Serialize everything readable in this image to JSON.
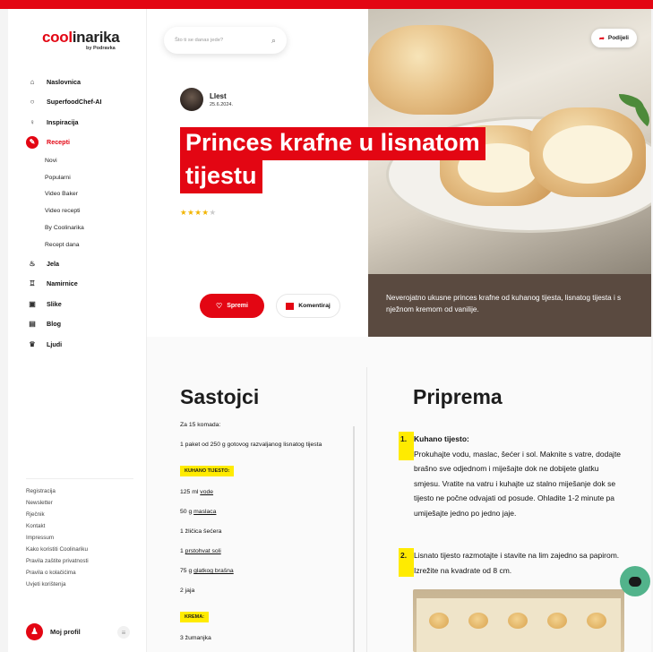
{
  "brand": {
    "logo_main": "coolinarika",
    "logo_accent": "coolinarika",
    "logo_sub": "by Podravka",
    "accent_color": "#e30613"
  },
  "sidebar": {
    "items": [
      {
        "label": "Naslovnica",
        "icon": "home-icon",
        "glyph": "⌂"
      },
      {
        "label": "SuperfoodChef-AI",
        "icon": "chat-icon",
        "glyph": "○"
      },
      {
        "label": "Inspiracija",
        "icon": "lightbulb-icon",
        "glyph": "♀"
      },
      {
        "label": "Recepti",
        "icon": "recipe-icon",
        "glyph": "✎",
        "active": true
      }
    ],
    "recepti_sub": [
      "Novi",
      "Popularni",
      "Video Baker",
      "Video recepti",
      "By Coolinarika",
      "Recept dana"
    ],
    "items_after": [
      {
        "label": "Jela",
        "icon": "dish-icon",
        "glyph": "♨"
      },
      {
        "label": "Namirnice",
        "icon": "ingredient-icon",
        "glyph": "♖"
      },
      {
        "label": "Slike",
        "icon": "image-icon",
        "glyph": "▣"
      },
      {
        "label": "Blog",
        "icon": "blog-icon",
        "glyph": "▤"
      },
      {
        "label": "Ljudi",
        "icon": "people-icon",
        "glyph": "♛"
      }
    ],
    "footer_links": [
      "Registracija",
      "Newsletter",
      "Rječnik",
      "Kontakt",
      "Impressum",
      "Kako koristiti Coolinariku",
      "Pravila zaštite privatnosti",
      "Pravila o kolačićima",
      "Uvjeti korištenja"
    ],
    "profile": {
      "label": "Moj profil",
      "icon": "user-icon",
      "menu_icon": "menu-icon"
    }
  },
  "search": {
    "placeholder": "Što ti se danas jede?",
    "icon": "search-icon"
  },
  "share": {
    "label": "Podijeli",
    "icon": "share-icon"
  },
  "recipe": {
    "author_name": "Llest",
    "date": "25.6.2024.",
    "title_line1": "Princes krafne u lisnatom",
    "title_line2": "tijestu",
    "rating": 3.5,
    "rating_max": 5,
    "description": "Neverojatno ukusne princes krafne od kuhanog tijesta, lisnatog tijesta i s nježnom kremom od vanilije."
  },
  "actions": {
    "save_label": "Spremi",
    "comment_label": "Komentiraj",
    "save_icon": "heart-icon",
    "comment_icon": "comment-icon"
  },
  "ingredients": {
    "title": "Sastojci",
    "servings": "Za 15 komada:",
    "intro": "1 paket od 250 g gotovog razvaljanog lisnatog tijesta",
    "groups": [
      {
        "name": "KUHANO TIJESTO:",
        "items": [
          {
            "pre": "125 ml ",
            "link": "vode",
            "post": ""
          },
          {
            "pre": "50 g ",
            "link": "maslaca",
            "post": ""
          },
          {
            "pre": "1 žličica šećera",
            "link": "",
            "post": ""
          },
          {
            "pre": "1 ",
            "link": "prstohvat soli",
            "post": ""
          },
          {
            "pre": "75 g ",
            "link": "glatkog brašna",
            "post": ""
          },
          {
            "pre": "2 jaja",
            "link": "",
            "post": ""
          }
        ]
      },
      {
        "name": "KREMA:",
        "items": [
          {
            "pre": "3 žumanjka",
            "link": "",
            "post": ""
          }
        ]
      }
    ]
  },
  "preparation": {
    "title": "Priprema",
    "steps": [
      {
        "num": "1.",
        "heading": "Kuhano tijesto:",
        "text": "Prokuhajte vodu, maslac, šećer i sol. Maknite s vatre, dodajte brašno sve odjednom i miješajte dok ne dobijete glatku smjesu. Vratite na vatru i kuhajte uz stalno miješanje dok se tijesto ne počne odvajati od posude. Ohladite 1-2 minute pa umiješajte jedno po jedno jaje."
      },
      {
        "num": "2.",
        "heading": "",
        "text": "Lisnato tijesto razmotajte i stavite na lim zajedno sa papirom. Izrežite na kvadrate od 8 cm."
      }
    ]
  },
  "chat": {
    "icon": "chat-bubble-icon"
  }
}
